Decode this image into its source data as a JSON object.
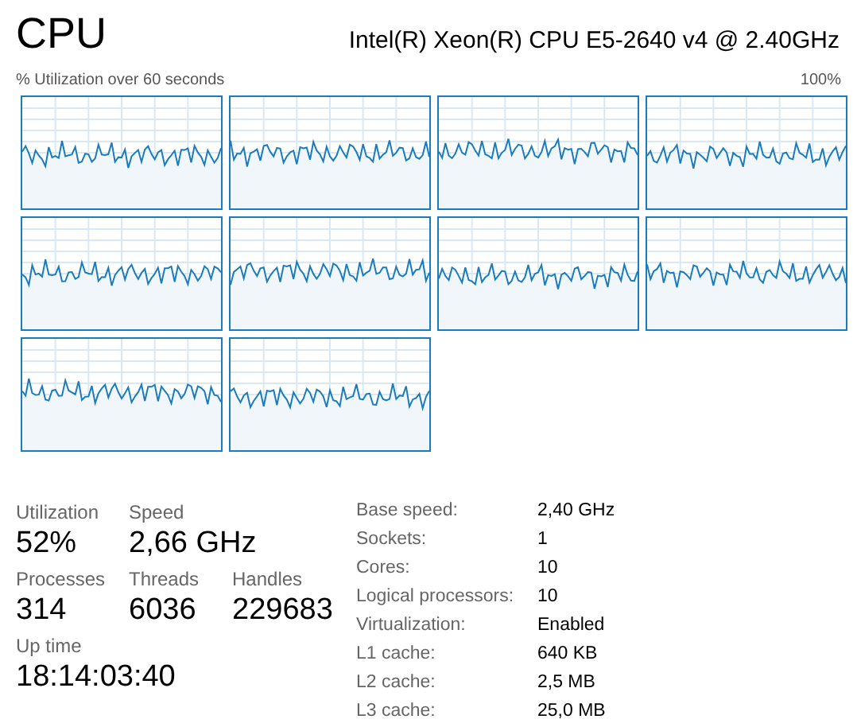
{
  "title": "CPU",
  "model": "Intel(R) Xeon(R) CPU E5-2640 v4 @ 2.40GHz",
  "graph_caption": "% Utilization over 60 seconds",
  "graph_max": "100%",
  "cpu_graphs": [
    {
      "kind": "graph"
    },
    {
      "kind": "graph"
    },
    {
      "kind": "graph"
    },
    {
      "kind": "graph"
    },
    {
      "kind": "graph"
    },
    {
      "kind": "graph"
    },
    {
      "kind": "graph"
    },
    {
      "kind": "graph"
    },
    {
      "kind": "graph"
    },
    {
      "kind": "graph"
    }
  ],
  "stat_rows": [
    [
      {
        "label": "Utilization",
        "value": "52%"
      },
      {
        "label": "Speed",
        "value": "2,66 GHz"
      }
    ],
    [
      {
        "label": "Processes",
        "value": "314"
      },
      {
        "label": "Threads",
        "value": "6036"
      },
      {
        "label": "Handles",
        "value": "229683"
      }
    ],
    [
      {
        "label": "Up time",
        "value": "18:14:03:40"
      }
    ]
  ],
  "details": [
    {
      "label": "Base speed:",
      "value": "2,40 GHz"
    },
    {
      "label": "Sockets:",
      "value": "1"
    },
    {
      "label": "Cores:",
      "value": "10"
    },
    {
      "label": "Logical processors:",
      "value": "10"
    },
    {
      "label": "Virtualization:",
      "value": "Enabled"
    },
    {
      "label": "L1 cache:",
      "value": "640 KB"
    },
    {
      "label": "L2 cache:",
      "value": "2,5 MB"
    },
    {
      "label": "L3 cache:",
      "value": "25,0 MB"
    }
  ]
}
